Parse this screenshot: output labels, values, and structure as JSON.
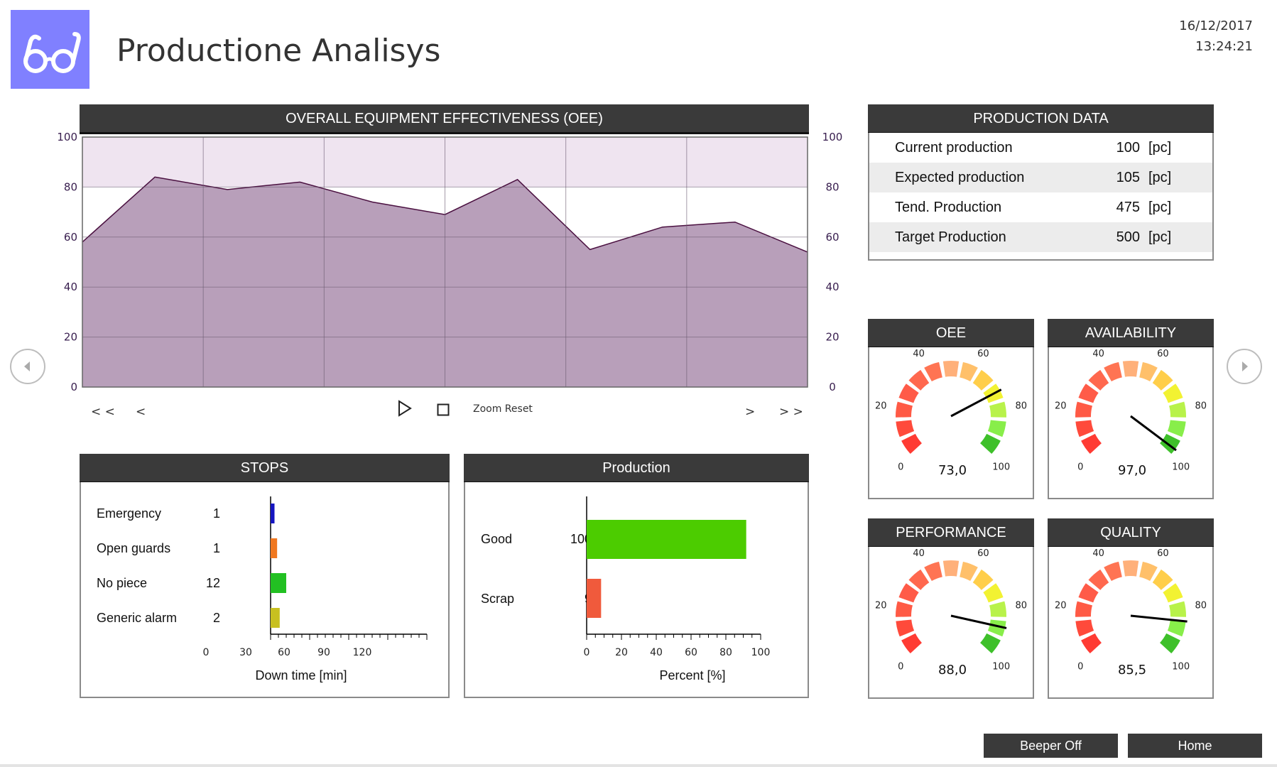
{
  "header": {
    "title": "Productione Analisys",
    "date": "16/12/2017",
    "time": "13:24:21",
    "logo_icon": "glasses-icon"
  },
  "oee_chart": {
    "title": "OVERALL EQUIPMENT EFFECTIVENESS (OEE)",
    "controls": {
      "first": "< <",
      "prev": "<",
      "zoom_reset": "Zoom Reset",
      "next": ">",
      "last": "> >"
    },
    "chart_data": {
      "type": "area",
      "y_ticks": [
        100,
        80,
        60,
        40,
        20,
        0
      ],
      "ylim": [
        0,
        100
      ],
      "values": [
        58,
        84,
        79,
        82,
        74,
        69,
        83,
        55,
        64,
        66,
        54
      ],
      "grid": true,
      "colors": {
        "fill": "#b89fba",
        "line": "#4a1040",
        "band": "#efe4f0"
      }
    }
  },
  "production_data": {
    "title": "PRODUCTION DATA",
    "rows": [
      {
        "label": "Current production",
        "value": "100",
        "unit": "[pc]"
      },
      {
        "label": "Expected production",
        "value": "105",
        "unit": "[pc]"
      },
      {
        "label": "Tend. Production",
        "value": "475",
        "unit": "[pc]"
      },
      {
        "label": "Target Production",
        "value": "500",
        "unit": "[pc]"
      }
    ]
  },
  "stops": {
    "title": "STOPS",
    "xlabel": "Down time [min]",
    "ticks": [
      "0",
      "30",
      "60",
      "90",
      "120"
    ],
    "chart_data": {
      "type": "bar",
      "categories": [
        "Emergency",
        "Open guards",
        "No piece",
        "Generic alarm"
      ],
      "values": [
        1,
        1,
        12,
        2
      ],
      "bar_values_min": [
        3,
        5,
        7,
        7
      ],
      "xlim": [
        0,
        120
      ],
      "colors": [
        "#1515c0",
        "#f07820",
        "#22c022",
        "#c8c020"
      ]
    },
    "counts": [
      "1",
      "1",
      "12",
      "2"
    ]
  },
  "production": {
    "title": "Production",
    "xlabel": "Percent [%]",
    "ticks": [
      "0",
      "20",
      "40",
      "60",
      "80",
      "100"
    ],
    "chart_data": {
      "type": "bar",
      "categories": [
        "Good",
        "Scrap"
      ],
      "values": [
        100,
        9
      ],
      "percent": [
        91.7,
        8.3
      ],
      "xlim": [
        0,
        100
      ],
      "colors": [
        "#4ccc00",
        "#f05a3c"
      ]
    },
    "counts": [
      "100",
      "9"
    ]
  },
  "gauges": [
    {
      "title": "OEE",
      "value_text": "73,0",
      "value": 73.0
    },
    {
      "title": "AVAILABILITY",
      "value_text": "97,0",
      "value": 97.0
    },
    {
      "title": "PERFORMANCE",
      "value_text": "88,0",
      "value": 88.0
    },
    {
      "title": "QUALITY",
      "value_text": "85,5",
      "value": 85.5
    }
  ],
  "gauge_scale": {
    "labels": [
      "0",
      "20",
      "40",
      "60",
      "80",
      "100"
    ]
  },
  "footer": {
    "beeper_label": "Beeper Off",
    "home_label": "Home"
  }
}
